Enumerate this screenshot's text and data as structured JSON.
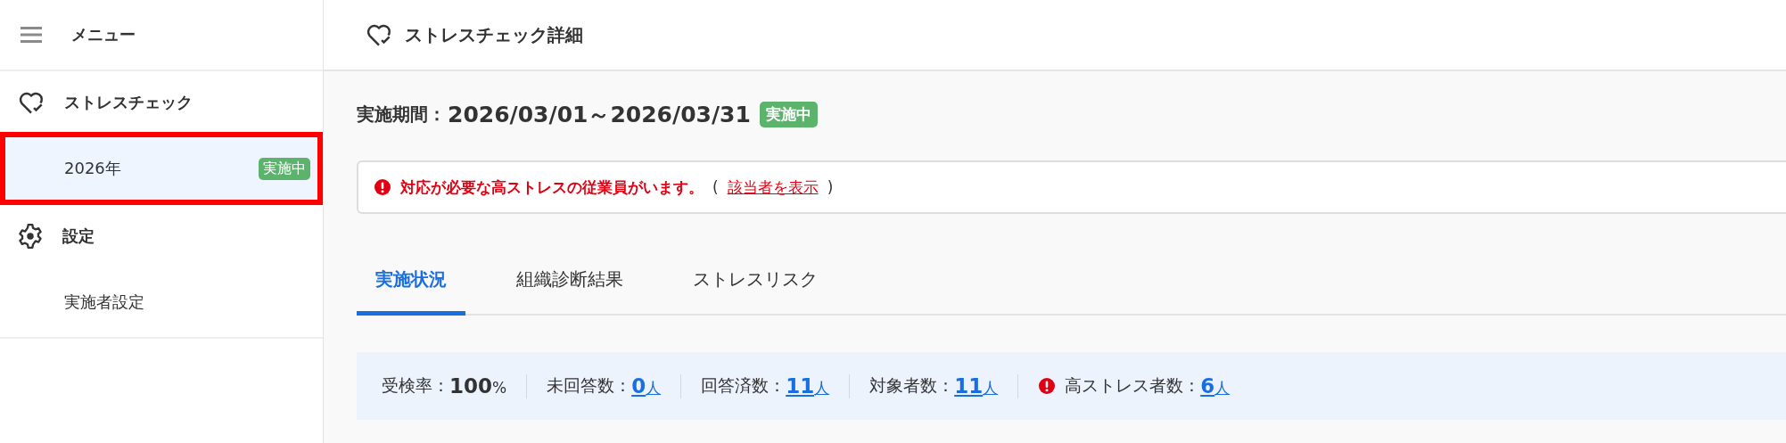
{
  "sidebar": {
    "title": "メニュー",
    "sections": [
      {
        "kind": "heart",
        "label": "ストレスチェック",
        "items": [
          {
            "label": "2026年",
            "badge": "実施中",
            "selected": true,
            "highlighted": true
          }
        ]
      },
      {
        "kind": "gear",
        "label": "設定",
        "items": [
          {
            "label": "実施者設定",
            "selected": false,
            "highlighted": false
          }
        ]
      }
    ]
  },
  "header": {
    "title": "ストレスチェック詳細"
  },
  "period": {
    "label": "実施期間：",
    "value": "2026/03/01～2026/03/31",
    "badge": "実施中"
  },
  "alert": {
    "message": "対応が必要な高ストレスの従業員がいます。",
    "open": "(",
    "link": "該当者を表示",
    "close": ")"
  },
  "tabs": [
    {
      "label": "実施状況",
      "selected": true
    },
    {
      "label": "組織診断結果",
      "selected": false
    },
    {
      "label": "ストレスリスク",
      "selected": false
    }
  ],
  "stats": [
    {
      "label": "受検率：",
      "value": "100",
      "unit": "%",
      "link": false,
      "warning": false
    },
    {
      "label": "未回答数：",
      "value": "0",
      "unit": "人",
      "link": true,
      "warning": false
    },
    {
      "label": "回答済数：",
      "value": "11",
      "unit": "人",
      "link": true,
      "warning": false
    },
    {
      "label": "対象者数：",
      "value": "11",
      "unit": "人",
      "link": true,
      "warning": false
    },
    {
      "label": "高ストレス者数：",
      "value": "6",
      "unit": "人",
      "link": true,
      "warning": true
    }
  ]
}
